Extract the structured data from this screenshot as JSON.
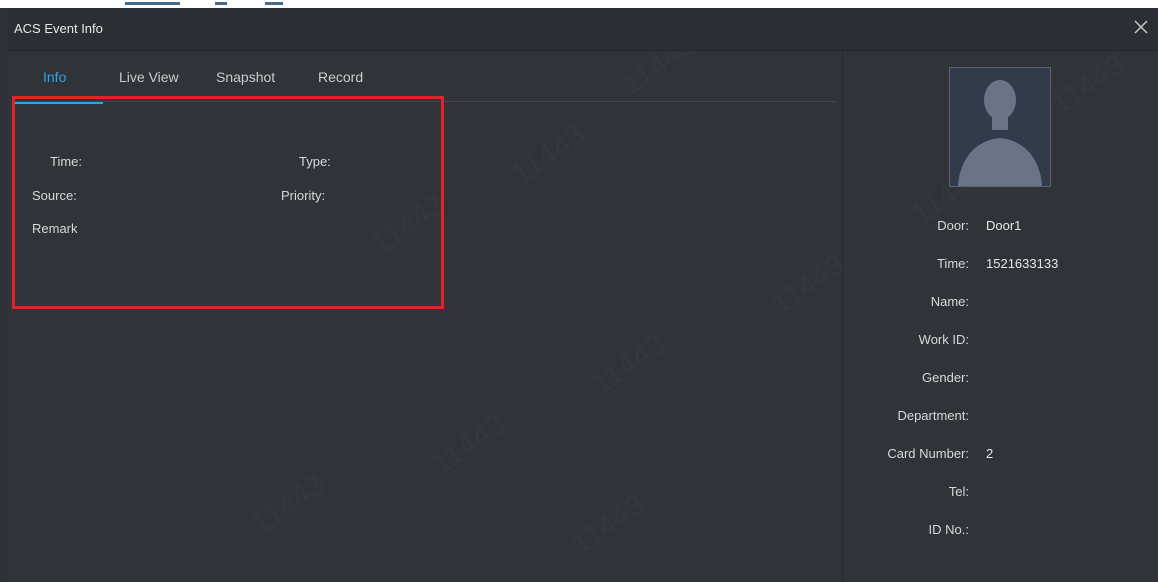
{
  "window": {
    "title": "ACS Event Info",
    "close_icon": "close-icon"
  },
  "tabs": [
    {
      "label": "Info",
      "active": true
    },
    {
      "label": "Live View",
      "active": false
    },
    {
      "label": "Snapshot",
      "active": false
    },
    {
      "label": "Record",
      "active": false
    }
  ],
  "info": {
    "time_label": "Time:",
    "type_label": "Type:",
    "source_label": "Source:",
    "priority_label": "Priority:",
    "remark_label": "Remark"
  },
  "person": {
    "avatar_icon": "person-silhouette-icon",
    "fields": [
      {
        "label": "Door:",
        "value": "Door1"
      },
      {
        "label": "Time:",
        "value": "1521633133"
      },
      {
        "label": "Name:",
        "value": ""
      },
      {
        "label": "Work ID:",
        "value": ""
      },
      {
        "label": "Gender:",
        "value": ""
      },
      {
        "label": "Department:",
        "value": ""
      },
      {
        "label": "Card Number:",
        "value": "2"
      },
      {
        "label": "Tel:",
        "value": ""
      },
      {
        "label": "ID No.:",
        "value": ""
      }
    ]
  },
  "watermark": "11443",
  "colors": {
    "accent": "#2aa6e6",
    "highlight": "#e3232b",
    "background": "#303338"
  }
}
